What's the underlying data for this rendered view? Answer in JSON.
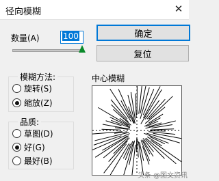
{
  "window": {
    "title": "径向模糊"
  },
  "amount": {
    "label": "数量(A)",
    "value": "100",
    "slider_fraction": 1.0
  },
  "buttons": {
    "ok": "确定",
    "reset": "复位"
  },
  "blur_method": {
    "legend": "模糊方法:",
    "options": [
      {
        "label": "旋转(S)",
        "checked": false
      },
      {
        "label": "缩放(Z)",
        "checked": true
      }
    ]
  },
  "quality": {
    "legend": "品质:",
    "options": [
      {
        "label": "草图(D)",
        "checked": false
      },
      {
        "label": "好(G)",
        "checked": true
      },
      {
        "label": "最好(B)",
        "checked": false
      }
    ]
  },
  "preview": {
    "label": "中心模糊"
  },
  "watermark": "头条 @图文资讯"
}
